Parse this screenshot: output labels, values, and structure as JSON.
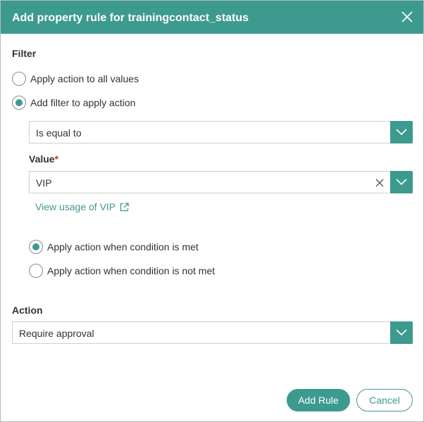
{
  "dialog": {
    "title": "Add property rule for trainingcontact_status",
    "close_icon": "close-icon"
  },
  "filter": {
    "label": "Filter",
    "options": [
      {
        "label": "Apply action to all values",
        "checked": false
      },
      {
        "label": "Add filter to apply action",
        "checked": true
      }
    ],
    "operator": {
      "selected": "Is equal to"
    },
    "value": {
      "label": "Value",
      "required_mark": "*",
      "selected": "VIP"
    },
    "usage_link": "View usage of VIP",
    "condition_options": [
      {
        "label": "Apply action when condition is met",
        "checked": true
      },
      {
        "label": "Apply action when condition is not met",
        "checked": false
      }
    ]
  },
  "action": {
    "label": "Action",
    "selected": "Require approval"
  },
  "buttons": {
    "add_rule": "Add Rule",
    "cancel": "Cancel"
  },
  "colors": {
    "accent": "#3d9a8e",
    "required": "#c0392b"
  }
}
